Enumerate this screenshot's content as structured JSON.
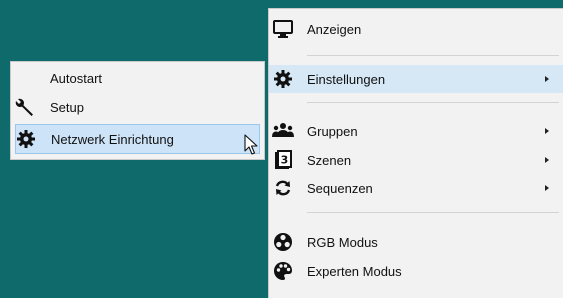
{
  "main_menu": {
    "items": [
      {
        "label": "Anzeigen",
        "icon": "monitor-icon"
      },
      {
        "label": "Einstellungen",
        "icon": "gear-icon",
        "has_submenu": true,
        "highlighted": true
      },
      {
        "label": "Gruppen",
        "icon": "group-icon",
        "has_submenu": true
      },
      {
        "label": "Szenen",
        "icon": "scene-3-icon",
        "has_submenu": true
      },
      {
        "label": "Sequenzen",
        "icon": "refresh-icon",
        "has_submenu": true
      },
      {
        "label": "RGB Modus",
        "icon": "rgb-icon"
      },
      {
        "label": "Experten Modus",
        "icon": "palette-icon"
      }
    ]
  },
  "sub_menu": {
    "items": [
      {
        "label": "Autostart",
        "icon": ""
      },
      {
        "label": "Setup",
        "icon": "wrench-icon"
      },
      {
        "label": "Netzwerk Einrichtung",
        "icon": "gear-icon",
        "highlighted": true
      }
    ]
  },
  "colors": {
    "desktop_teal": "#0f6a6b",
    "menu_bg": "#f2f2f2",
    "highlight": "#d6e7f6"
  }
}
